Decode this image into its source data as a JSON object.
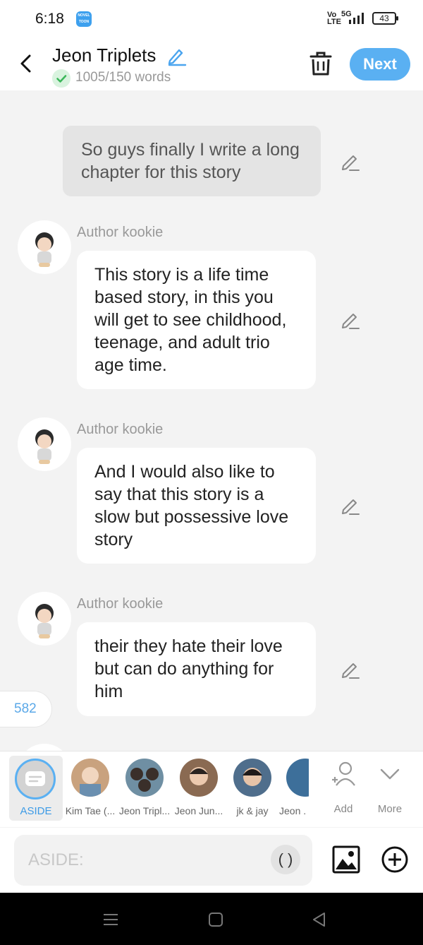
{
  "status": {
    "time": "6:18",
    "app_icon_text": "NOVEL TOON",
    "network": "Vo LTE",
    "net_5g": "5G",
    "battery": "43"
  },
  "header": {
    "title": "Jeon Triplets",
    "word_count": "1005/150 words",
    "next_label": "Next"
  },
  "messages": [
    {
      "type": "aside",
      "text": "So guys finally I write a long chapter for this story"
    },
    {
      "type": "character",
      "author": "Author kookie",
      "text": "This story is a life time based story, in this you will get to see childhood, teenage, and adult trio age time."
    },
    {
      "type": "character",
      "author": "Author kookie",
      "text": "And I would also like to say that this story is a slow but possessive love story"
    },
    {
      "type": "character",
      "author": "Author kookie",
      "text": "their they hate their love but can do anything for him"
    }
  ],
  "badge_count": "582",
  "characters": {
    "aside_label": "ASIDE",
    "list": [
      {
        "name": "Kim Tae (...",
        "color": "#c9a27e"
      },
      {
        "name": "Jeon Tripl...",
        "color": "#6f8fa3"
      },
      {
        "name": "Jeon Jun...",
        "color": "#8a6a52"
      },
      {
        "name": "jk & jay",
        "color": "#4f6e8c"
      },
      {
        "name": "Jeon .",
        "color": "#3d6f9a"
      }
    ],
    "add_label": "Add",
    "more_label": "More"
  },
  "composer": {
    "placeholder": "ASIDE:",
    "paren_label": "( )"
  },
  "colors": {
    "accent": "#5ab0f2",
    "bubble": "#ffffff",
    "aside_bubble": "#e4e4e4"
  },
  "icons": [
    "back-icon",
    "pencil-icon",
    "check-icon",
    "trash-icon",
    "add-person-icon",
    "chevron-down-icon",
    "image-icon",
    "plus-circle-icon",
    "menu-icon",
    "home-icon",
    "back-triangle-icon"
  ]
}
